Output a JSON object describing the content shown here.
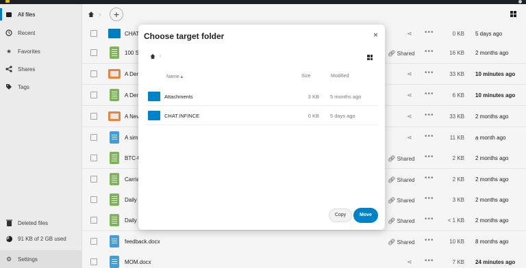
{
  "sidebar": {
    "items": [
      {
        "label": "All files"
      },
      {
        "label": "Recent"
      },
      {
        "label": "Favorites"
      },
      {
        "label": "Shares"
      },
      {
        "label": "Tags"
      }
    ],
    "deleted": "Deleted files",
    "quota": "91 KB of 2 GB used",
    "settings": "Settings"
  },
  "files": [
    {
      "name": "CHAT",
      "shared": "",
      "size": "0 KB",
      "modified": "5 days ago",
      "type": "folder"
    },
    {
      "name": "100 S",
      "shared": "Shared",
      "size": "16 KB",
      "modified": "2 months ago",
      "type": "sheet"
    },
    {
      "name": "A Der",
      "shared": "",
      "size": "33 KB",
      "modified": "10 minutes ago",
      "type": "pres"
    },
    {
      "name": "A Der",
      "shared": "",
      "size": "6 KB",
      "modified": "10 minutes ago",
      "type": "sheet"
    },
    {
      "name": "A Nev",
      "shared": "",
      "size": "33 KB",
      "modified": "2 months ago",
      "type": "pres"
    },
    {
      "name": "A sim",
      "shared": "",
      "size": "11 KB",
      "modified": "a month ago",
      "type": "doc"
    },
    {
      "name": "BTC-U",
      "shared": "Shared",
      "size": "2 KB",
      "modified": "2 months ago",
      "type": "sheet"
    },
    {
      "name": "Carria",
      "shared": "Shared",
      "size": "2 KB",
      "modified": "2 months ago",
      "type": "sheet"
    },
    {
      "name": "Daily",
      "shared": "Shared",
      "size": "3 KB",
      "modified": "2 months ago",
      "type": "sheet"
    },
    {
      "name": "Daily",
      "shared": "Shared",
      "size": "< 1 KB",
      "modified": "2 months ago",
      "type": "sheet"
    },
    {
      "name": "feedback.docx",
      "shared": "Shared",
      "size": "10 KB",
      "modified": "8 months ago",
      "type": "doc"
    },
    {
      "name": "MOM.docx",
      "shared": "",
      "size": "7 KB",
      "modified": "24 minutes ago",
      "type": "doc"
    }
  ],
  "modal": {
    "title": "Choose target folder",
    "close": "×",
    "headers": {
      "name": "Name ▴",
      "size": "Size",
      "modified": "Modified"
    },
    "folders": [
      {
        "name": "Attachments",
        "size": "3 KB",
        "modified": "5 months ago"
      },
      {
        "name": "CHAT.INFINCE",
        "size": "0 KB",
        "modified": "5 days ago"
      }
    ],
    "copy": "Copy",
    "move": "Move"
  },
  "icons": {
    "share": "share-icon",
    "more": "more-icon",
    "home": "home-icon",
    "grid": "grid-view-icon"
  },
  "colors": {
    "accent": "#0082c9",
    "folder": "#0082c9",
    "sheet": "#83bc5b",
    "presentation": "#e98d46",
    "document": "#4aa3df"
  }
}
